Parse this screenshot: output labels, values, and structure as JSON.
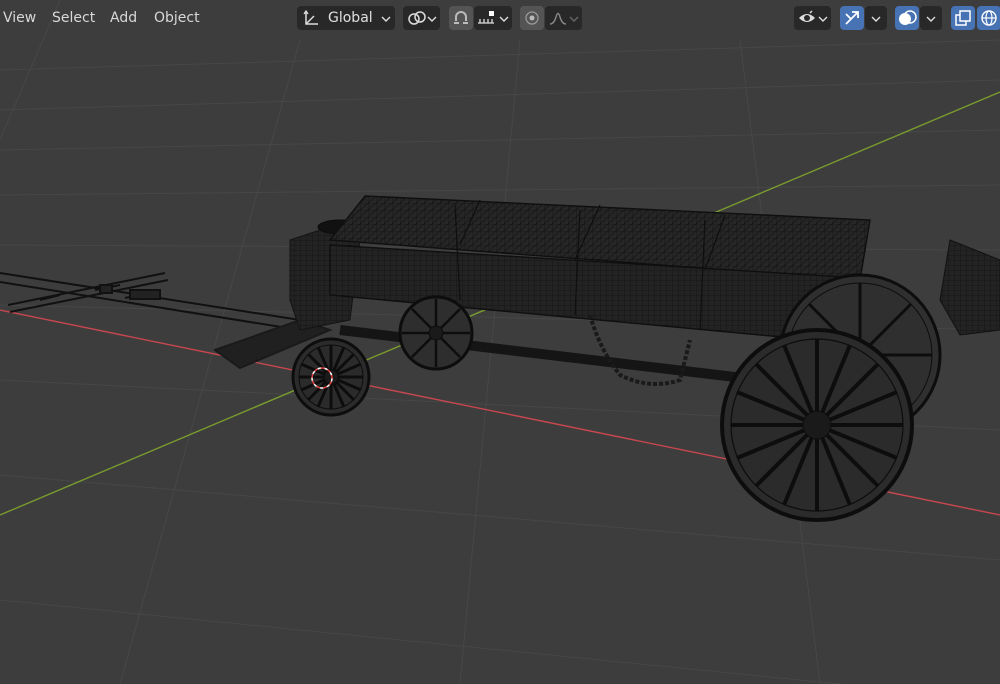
{
  "menu": {
    "view": "View",
    "select": "Select",
    "add": "Add",
    "object": "Object"
  },
  "header": {
    "transform_orientation": "Global",
    "transform_icon": "transform-orientation-icon",
    "pivot_icon": "pivot-point-icon",
    "snap_icon": "snap-magnet-icon",
    "snap_target_icon": "snap-increment-icon",
    "proportional_icon": "proportional-edit-icon",
    "falloff_icon": "falloff-curve-icon",
    "visibility_icon": "eye-visibility-icon",
    "gizmo_icon": "gizmo-icon",
    "overlay_icon": "overlay-icon",
    "xray_icon": "xray-toggle-icon",
    "shading_icon": "wireframe-shading-icon"
  },
  "colors": {
    "background": "#3d3d3d",
    "x_axis": "#c8474f",
    "y_axis": "#7a9b2e",
    "grid": "#474747",
    "accent": "#4772b3",
    "model": "#101010"
  }
}
